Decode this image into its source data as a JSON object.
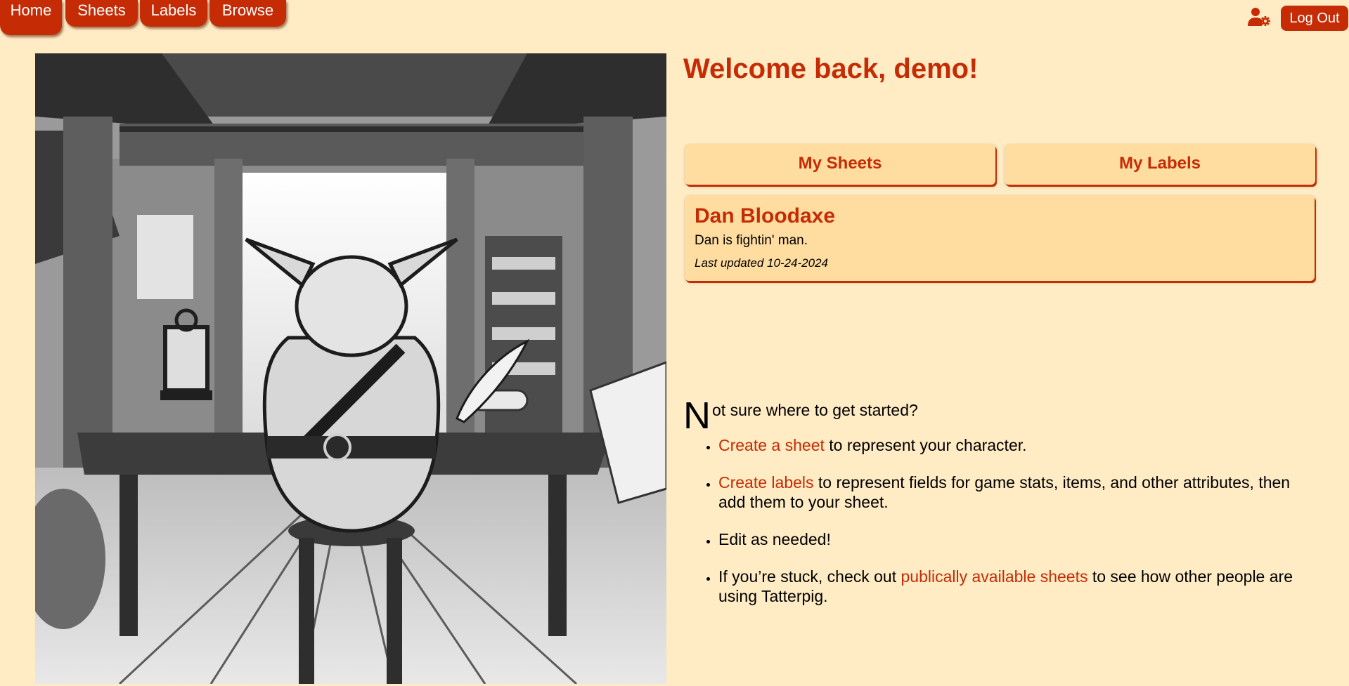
{
  "nav": {
    "home": "Home",
    "sheets": "Sheets",
    "labels": "Labels",
    "browse": "Browse"
  },
  "header": {
    "account_icon": "user-gear-icon",
    "logout_label": "Log Out"
  },
  "hero": {
    "icon": "pig-scribe-illustration"
  },
  "welcome": "Welcome back, demo!",
  "buttons": {
    "my_sheets": "My Sheets",
    "my_labels": "My Labels"
  },
  "sheets": [
    {
      "title": "Dan Bloodaxe",
      "description": "Dan is fightin' man.",
      "updated": "Last updated 10-24-2024"
    }
  ],
  "intro": {
    "dropcap": "N",
    "rest": "ot sure where to get started?"
  },
  "tips": {
    "tip1_link": "Create a sheet",
    "tip1_rest": " to represent your character.",
    "tip2_link": "Create labels",
    "tip2_rest": " to represent fields for game stats, items, and other attributes, then add them to your sheet.",
    "tip3": "Edit as needed!",
    "tip4_pre": "If you’re stuck, check out ",
    "tip4_link": "publically available sheets",
    "tip4_rest": " to see how other people are using Tatterpig."
  },
  "colors": {
    "background": "#ffebc4",
    "accent": "#c52c05",
    "card": "#ffdc9f"
  }
}
